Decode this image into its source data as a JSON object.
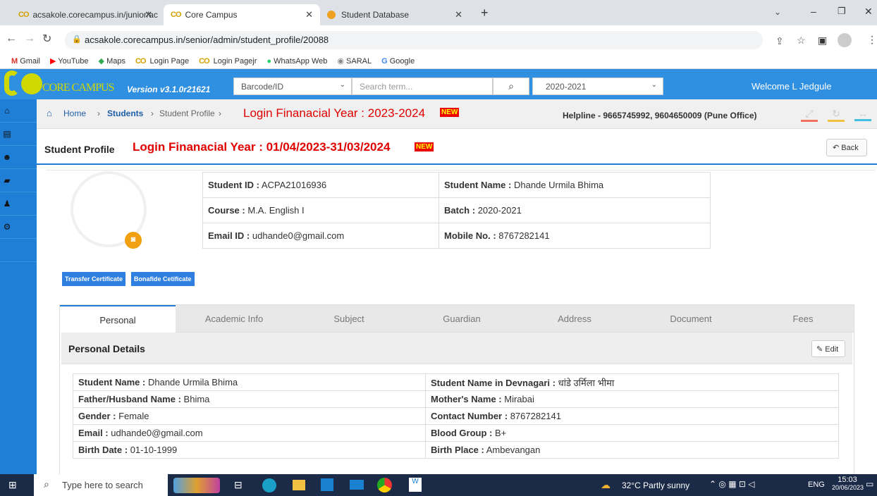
{
  "browser": {
    "tabs": [
      {
        "label": "acsakole.corecampus.in/junior/ac"
      },
      {
        "label": "Core Campus"
      },
      {
        "label": "Student Database"
      }
    ],
    "url": "acsakole.corecampus.in/senior/admin/student_profile/20088",
    "bookmarks": [
      "Gmail",
      "YouTube",
      "Maps",
      "Login Page",
      "Login Pagejr",
      "WhatsApp Web",
      "SARAL",
      "Google"
    ]
  },
  "app": {
    "logo": "CORE CAMPUS",
    "version": "Version v3.1.0r21621",
    "search_type": "Barcode/ID",
    "search_placeholder": "Search term...",
    "year": "2020-2021",
    "welcome": "Welcome L Jedgule",
    "colors": {
      "header": "#2f8fe0",
      "sidebar": "#1f7fd6",
      "red": "#e00000"
    }
  },
  "crumb": {
    "home": "Home",
    "students": "Students",
    "profile": "Student Profile",
    "fy": "Login Finanacial Year : 2023-2024",
    "helpline": "Helpline - 9665745992, 9604650009 (Pune Office)"
  },
  "profile": {
    "title": "Student Profile",
    "fy": "Login Finanacial Year : 01/04/2023-31/03/2024",
    "back": "Back",
    "id_label": "Student ID :",
    "id": "ACPA21016936",
    "name_label": "Student Name :",
    "name": "Dhande Urmila Bhima",
    "course_label": "Course :",
    "course": "M.A. English I",
    "batch_label": "Batch :",
    "batch": "2020-2021",
    "email_label": "Email ID :",
    "email": "udhande0@gmail.com",
    "mobile_label": "Mobile No. :",
    "mobile": "8767282141",
    "tc": "Transfer Certificate",
    "bc": "Bonafide Cetificate"
  },
  "tabs": [
    "Personal",
    "Academic Info",
    "Subject",
    "Guardian",
    "Address",
    "Document",
    "Fees"
  ],
  "personal": {
    "heading": "Personal Details",
    "edit": "Edit",
    "rows": [
      [
        {
          "k": "Student Name :",
          "v": "Dhande Urmila Bhima"
        },
        {
          "k": "Student Name in Devnagari :",
          "v": "धांडे उर्मिला भीमा"
        }
      ],
      [
        {
          "k": "Father/Husband Name :",
          "v": "Bhima"
        },
        {
          "k": "Mother's Name :",
          "v": "Mirabai"
        }
      ],
      [
        {
          "k": "Gender :",
          "v": "Female"
        },
        {
          "k": "Contact Number :",
          "v": "8767282141"
        }
      ],
      [
        {
          "k": "Email :",
          "v": "udhande0@gmail.com"
        },
        {
          "k": "Blood Group :",
          "v": "B+"
        }
      ],
      [
        {
          "k": "Birth Date :",
          "v": "01-10-1999"
        },
        {
          "k": "Birth Place :",
          "v": "Ambevangan"
        }
      ]
    ]
  },
  "taskbar": {
    "search": "Type here to search",
    "weather": "32°C  Partly sunny",
    "lang": "ENG",
    "time": "15:03",
    "date": "20/06/2023"
  }
}
